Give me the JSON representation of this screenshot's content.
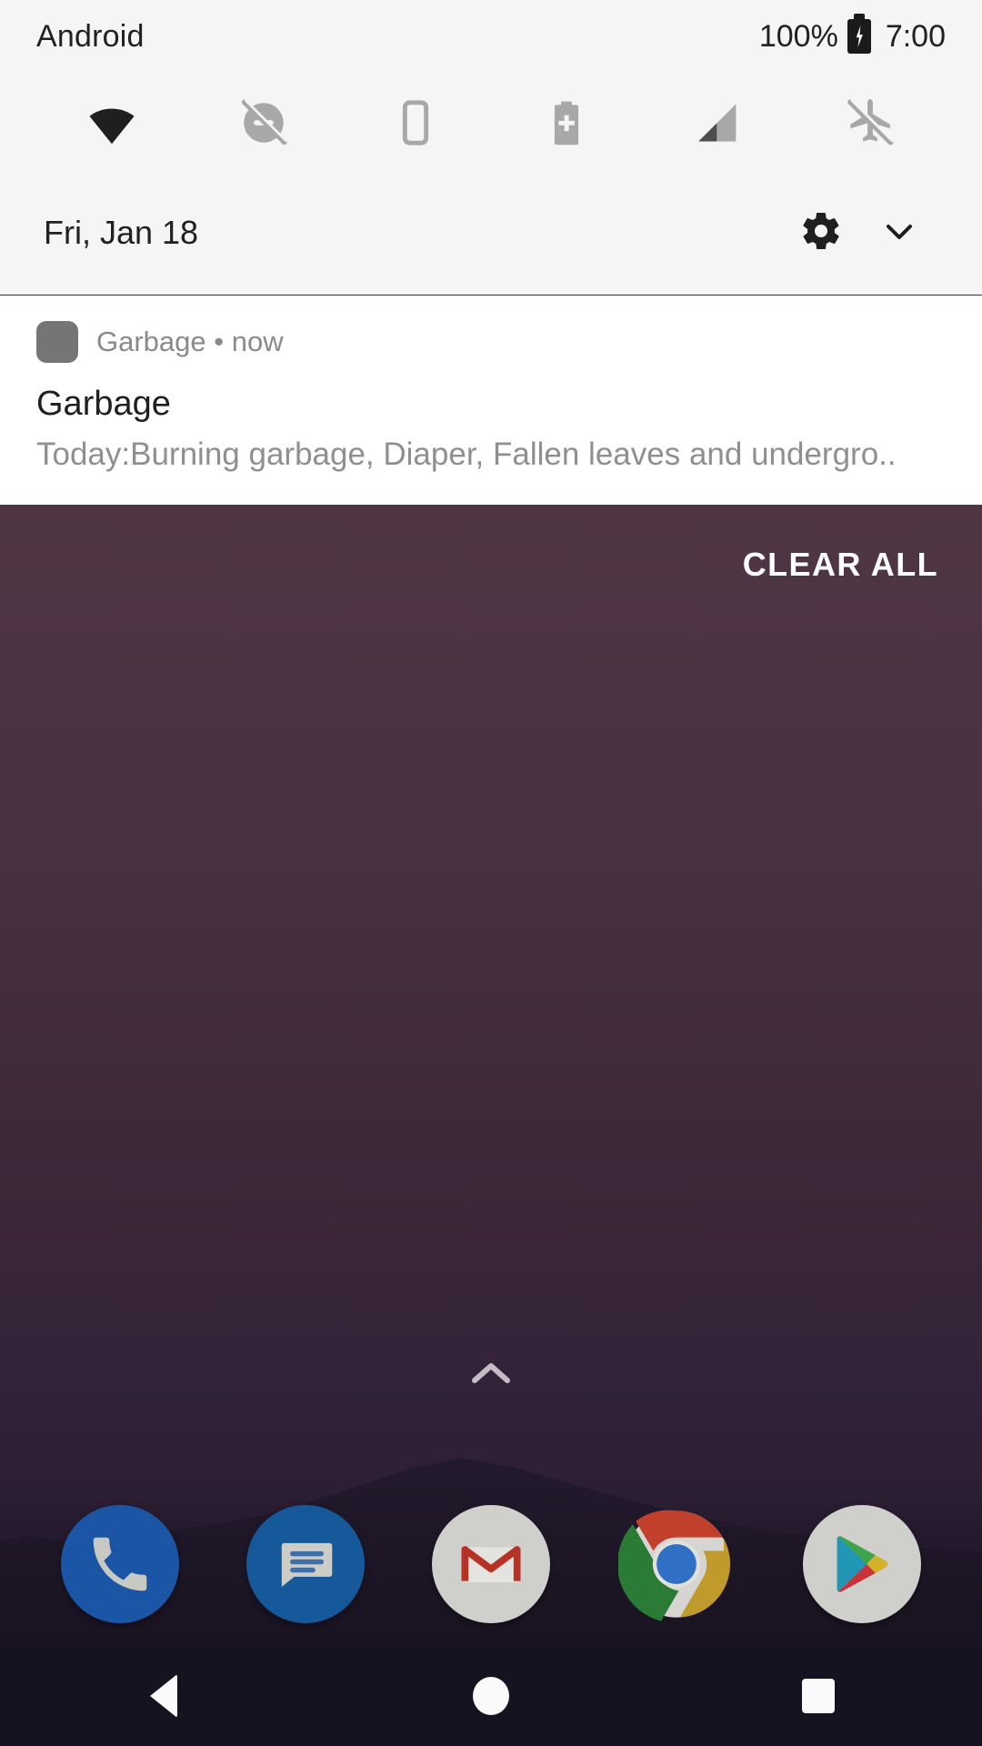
{
  "statusbar": {
    "carrier": "Android",
    "battery_percent": "100%",
    "battery_icon": "battery-charging-icon",
    "clock": "7:00"
  },
  "quick_settings": {
    "tiles": [
      {
        "name": "wifi-icon",
        "label": "Wi-Fi",
        "state": "on"
      },
      {
        "name": "do-not-disturb-off-icon",
        "label": "Do Not Disturb",
        "state": "off"
      },
      {
        "name": "phone-device-icon",
        "label": "Device",
        "state": "off"
      },
      {
        "name": "battery-saver-icon",
        "label": "Battery Saver",
        "state": "off"
      },
      {
        "name": "signal-bars-icon",
        "label": "Mobile Signal",
        "state": "on"
      },
      {
        "name": "airplane-mode-off-icon",
        "label": "Airplane Mode",
        "state": "off"
      }
    ]
  },
  "date_row": {
    "date": "Fri, Jan 18",
    "settings_icon": "gear-icon",
    "expand_icon": "chevron-down-icon"
  },
  "notification": {
    "app_icon": "app-placeholder-icon",
    "app_line": "Garbage • now",
    "app_name": "Garbage",
    "time": "now",
    "title": "Garbage",
    "body": "Today:Burning garbage, Diaper, Fallen leaves and undergro.."
  },
  "shade_actions": {
    "clear_all": "CLEAR ALL"
  },
  "home": {
    "drawer_handle_icon": "chevron-up-icon",
    "dock": [
      {
        "name": "dock-icon-phone",
        "label": "Phone"
      },
      {
        "name": "dock-icon-messages",
        "label": "Messages"
      },
      {
        "name": "dock-icon-gmail",
        "label": "Gmail"
      },
      {
        "name": "dock-icon-chrome",
        "label": "Chrome"
      },
      {
        "name": "dock-icon-play-store",
        "label": "Play Store"
      }
    ]
  },
  "navbar": {
    "back": "Back",
    "home": "Home",
    "recents": "Recents"
  },
  "colors": {
    "shade_bg": "#f5f5f5",
    "notification_bg": "#ffffff",
    "wallpaper_top": "#5b3c49",
    "wallpaper_bottom": "#221830",
    "navbar_bg": "#17121f",
    "accent_text": "#212121"
  }
}
